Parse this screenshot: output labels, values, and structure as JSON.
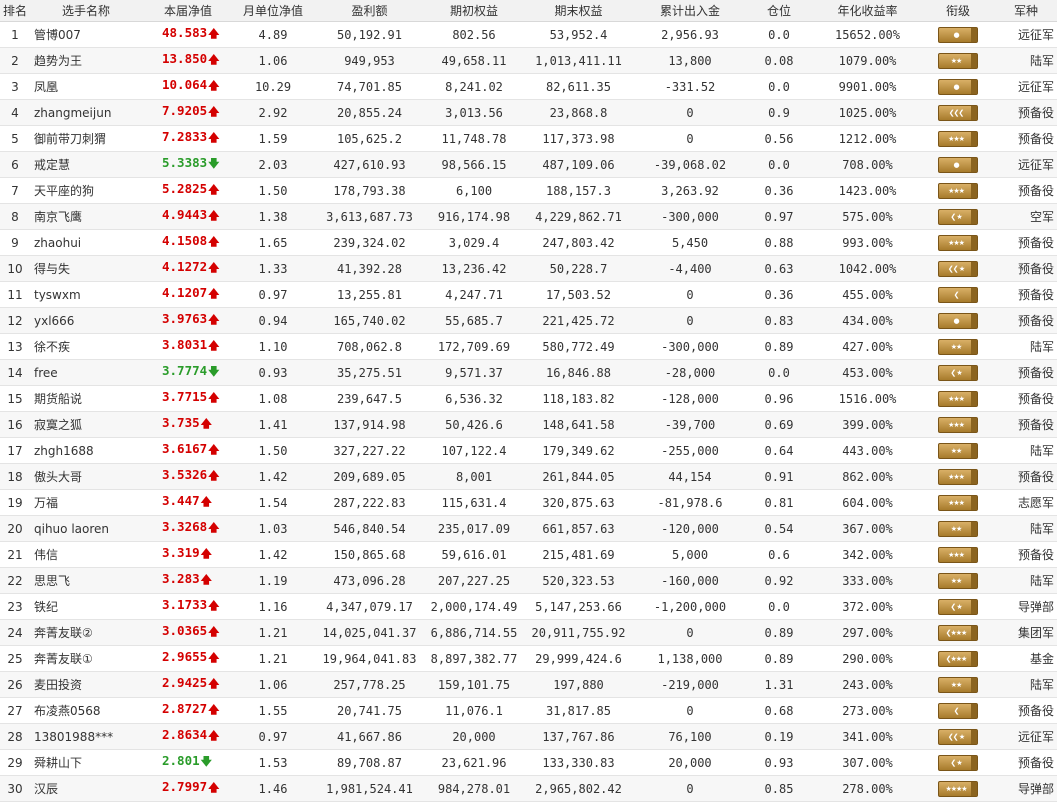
{
  "headers": [
    "排名",
    "选手名称",
    "本届净值",
    "月单位净值",
    "盈利额",
    "期初权益",
    "期末权益",
    "累计出入金",
    "仓位",
    "年化收益率",
    "衔级",
    "军种"
  ],
  "colors": {
    "up": "#d40000",
    "down": "#2a9c2a",
    "badge": "#c49a4c"
  },
  "rows": [
    {
      "rank": "1",
      "name": "管博007",
      "nav": "48.583",
      "dir": "up",
      "mnav": "4.89",
      "pnl": "50,192.91",
      "beg": "802.56",
      "end": "53,952.4",
      "flow": "2,956.93",
      "pos": "0.0",
      "ann": "15652.00%",
      "badge": "●",
      "army": "远征军"
    },
    {
      "rank": "2",
      "name": "趋势为王",
      "nav": "13.850",
      "dir": "up",
      "mnav": "1.06",
      "pnl": "949,953",
      "beg": "49,658.11",
      "end": "1,013,411.11",
      "flow": "13,800",
      "pos": "0.08",
      "ann": "1079.00%",
      "badge": "★★",
      "army": "陆军"
    },
    {
      "rank": "3",
      "name": "凤凰",
      "nav": "10.064",
      "dir": "up",
      "mnav": "10.29",
      "pnl": "74,701.85",
      "beg": "8,241.02",
      "end": "82,611.35",
      "flow": "-331.52",
      "pos": "0.0",
      "ann": "9901.00%",
      "badge": "●",
      "army": "远征军"
    },
    {
      "rank": "4",
      "name": "zhangmeijun",
      "nav": "7.9205",
      "dir": "up",
      "mnav": "2.92",
      "pnl": "20,855.24",
      "beg": "3,013.56",
      "end": "23,868.8",
      "flow": "0",
      "pos": "0.9",
      "ann": "1025.00%",
      "badge": "❮❮❮",
      "army": "预备役"
    },
    {
      "rank": "5",
      "name": "御前带刀刺猬",
      "nav": "7.2833",
      "dir": "up",
      "mnav": "1.59",
      "pnl": "105,625.2",
      "beg": "11,748.78",
      "end": "117,373.98",
      "flow": "0",
      "pos": "0.56",
      "ann": "1212.00%",
      "badge": "★★★",
      "army": "预备役"
    },
    {
      "rank": "6",
      "name": "戒定慧",
      "nav": "5.3383",
      "dir": "down",
      "mnav": "2.03",
      "pnl": "427,610.93",
      "beg": "98,566.15",
      "end": "487,109.06",
      "flow": "-39,068.02",
      "pos": "0.0",
      "ann": "708.00%",
      "badge": "●",
      "army": "远征军"
    },
    {
      "rank": "7",
      "name": "天平座的狗",
      "nav": "5.2825",
      "dir": "up",
      "mnav": "1.50",
      "pnl": "178,793.38",
      "beg": "6,100",
      "end": "188,157.3",
      "flow": "3,263.92",
      "pos": "0.36",
      "ann": "1423.00%",
      "badge": "★★★",
      "army": "预备役"
    },
    {
      "rank": "8",
      "name": "南京飞鹰",
      "nav": "4.9443",
      "dir": "up",
      "mnav": "1.38",
      "pnl": "3,613,687.73",
      "beg": "916,174.98",
      "end": "4,229,862.71",
      "flow": "-300,000",
      "pos": "0.97",
      "ann": "575.00%",
      "badge": "❮ ★",
      "army": "空军"
    },
    {
      "rank": "9",
      "name": "zhaohui",
      "nav": "4.1508",
      "dir": "up",
      "mnav": "1.65",
      "pnl": "239,324.02",
      "beg": "3,029.4",
      "end": "247,803.42",
      "flow": "5,450",
      "pos": "0.88",
      "ann": "993.00%",
      "badge": "★★★",
      "army": "预备役"
    },
    {
      "rank": "10",
      "name": "得与失",
      "nav": "4.1272",
      "dir": "up",
      "mnav": "1.33",
      "pnl": "41,392.28",
      "beg": "13,236.42",
      "end": "50,228.7",
      "flow": "-4,400",
      "pos": "0.63",
      "ann": "1042.00%",
      "badge": "❮❮ ★",
      "army": "预备役"
    },
    {
      "rank": "11",
      "name": "tyswxm",
      "nav": "4.1207",
      "dir": "up",
      "mnav": "0.97",
      "pnl": "13,255.81",
      "beg": "4,247.71",
      "end": "17,503.52",
      "flow": "0",
      "pos": "0.36",
      "ann": "455.00%",
      "badge": "❮",
      "army": "预备役"
    },
    {
      "rank": "12",
      "name": "yxl666",
      "nav": "3.9763",
      "dir": "up",
      "mnav": "0.94",
      "pnl": "165,740.02",
      "beg": "55,685.7",
      "end": "221,425.72",
      "flow": "0",
      "pos": "0.83",
      "ann": "434.00%",
      "badge": "●",
      "army": "预备役"
    },
    {
      "rank": "13",
      "name": "徐不疾",
      "nav": "3.8031",
      "dir": "up",
      "mnav": "1.10",
      "pnl": "708,062.8",
      "beg": "172,709.69",
      "end": "580,772.49",
      "flow": "-300,000",
      "pos": "0.89",
      "ann": "427.00%",
      "badge": "★★",
      "army": "陆军"
    },
    {
      "rank": "14",
      "name": "free",
      "nav": "3.7774",
      "dir": "down",
      "mnav": "0.93",
      "pnl": "35,275.51",
      "beg": "9,571.37",
      "end": "16,846.88",
      "flow": "-28,000",
      "pos": "0.0",
      "ann": "453.00%",
      "badge": "❮ ★",
      "army": "预备役"
    },
    {
      "rank": "15",
      "name": "期货船说",
      "nav": "3.7715",
      "dir": "up",
      "mnav": "1.08",
      "pnl": "239,647.5",
      "beg": "6,536.32",
      "end": "118,183.82",
      "flow": "-128,000",
      "pos": "0.96",
      "ann": "1516.00%",
      "badge": "★★★",
      "army": "预备役"
    },
    {
      "rank": "16",
      "name": "寂寞之狐",
      "nav": "3.735",
      "dir": "up",
      "mnav": "1.41",
      "pnl": "137,914.98",
      "beg": "50,426.6",
      "end": "148,641.58",
      "flow": "-39,700",
      "pos": "0.69",
      "ann": "399.00%",
      "badge": "★★★",
      "army": "预备役"
    },
    {
      "rank": "17",
      "name": "zhgh1688",
      "nav": "3.6167",
      "dir": "up",
      "mnav": "1.50",
      "pnl": "327,227.22",
      "beg": "107,122.4",
      "end": "179,349.62",
      "flow": "-255,000",
      "pos": "0.64",
      "ann": "443.00%",
      "badge": "★★",
      "army": "陆军"
    },
    {
      "rank": "18",
      "name": "傲头大哥",
      "nav": "3.5326",
      "dir": "up",
      "mnav": "1.42",
      "pnl": "209,689.05",
      "beg": "8,001",
      "end": "261,844.05",
      "flow": "44,154",
      "pos": "0.91",
      "ann": "862.00%",
      "badge": "★★★",
      "army": "预备役"
    },
    {
      "rank": "19",
      "name": "万福",
      "nav": "3.447",
      "dir": "up",
      "mnav": "1.54",
      "pnl": "287,222.83",
      "beg": "115,631.4",
      "end": "320,875.63",
      "flow": "-81,978.6",
      "pos": "0.81",
      "ann": "604.00%",
      "badge": "★★★",
      "army": "志愿军"
    },
    {
      "rank": "20",
      "name": "qihuo laoren",
      "nav": "3.3268",
      "dir": "up",
      "mnav": "1.03",
      "pnl": "546,840.54",
      "beg": "235,017.09",
      "end": "661,857.63",
      "flow": "-120,000",
      "pos": "0.54",
      "ann": "367.00%",
      "badge": "★★",
      "army": "陆军"
    },
    {
      "rank": "21",
      "name": "伟信",
      "nav": "3.319",
      "dir": "up",
      "mnav": "1.42",
      "pnl": "150,865.68",
      "beg": "59,616.01",
      "end": "215,481.69",
      "flow": "5,000",
      "pos": "0.6",
      "ann": "342.00%",
      "badge": "★★★",
      "army": "预备役"
    },
    {
      "rank": "22",
      "name": "思思飞",
      "nav": "3.283",
      "dir": "up",
      "mnav": "1.19",
      "pnl": "473,096.28",
      "beg": "207,227.25",
      "end": "520,323.53",
      "flow": "-160,000",
      "pos": "0.92",
      "ann": "333.00%",
      "badge": "★★",
      "army": "陆军"
    },
    {
      "rank": "23",
      "name": "铁纪",
      "nav": "3.1733",
      "dir": "up",
      "mnav": "1.16",
      "pnl": "4,347,079.17",
      "beg": "2,000,174.49",
      "end": "5,147,253.66",
      "flow": "-1,200,000",
      "pos": "0.0",
      "ann": "372.00%",
      "badge": "❮ ★",
      "army": "导弹部"
    },
    {
      "rank": "24",
      "name": "奔菁友联②",
      "nav": "3.0365",
      "dir": "up",
      "mnav": "1.21",
      "pnl": "14,025,041.37",
      "beg": "6,886,714.55",
      "end": "20,911,755.92",
      "flow": "0",
      "pos": "0.89",
      "ann": "297.00%",
      "badge": "❮★★★",
      "army": "集团军"
    },
    {
      "rank": "25",
      "name": "奔菁友联①",
      "nav": "2.9655",
      "dir": "up",
      "mnav": "1.21",
      "pnl": "19,964,041.83",
      "beg": "8,897,382.77",
      "end": "29,999,424.6",
      "flow": "1,138,000",
      "pos": "0.89",
      "ann": "290.00%",
      "badge": "❮★★★",
      "army": "基金"
    },
    {
      "rank": "26",
      "name": "麦田投资",
      "nav": "2.9425",
      "dir": "up",
      "mnav": "1.06",
      "pnl": "257,778.25",
      "beg": "159,101.75",
      "end": "197,880",
      "flow": "-219,000",
      "pos": "1.31",
      "ann": "243.00%",
      "badge": "★★",
      "army": "陆军"
    },
    {
      "rank": "27",
      "name": "布凌燕0568",
      "nav": "2.8727",
      "dir": "up",
      "mnav": "1.55",
      "pnl": "20,741.75",
      "beg": "11,076.1",
      "end": "31,817.85",
      "flow": "0",
      "pos": "0.68",
      "ann": "273.00%",
      "badge": "❮",
      "army": "预备役"
    },
    {
      "rank": "28",
      "name": "13801988***",
      "nav": "2.8634",
      "dir": "up",
      "mnav": "0.97",
      "pnl": "41,667.86",
      "beg": "20,000",
      "end": "137,767.86",
      "flow": "76,100",
      "pos": "0.19",
      "ann": "341.00%",
      "badge": "❮❮ ★",
      "army": "远征军"
    },
    {
      "rank": "29",
      "name": "舜耕山下",
      "nav": "2.801",
      "dir": "down",
      "mnav": "1.53",
      "pnl": "89,708.87",
      "beg": "23,621.96",
      "end": "133,330.83",
      "flow": "20,000",
      "pos": "0.93",
      "ann": "307.00%",
      "badge": "❮ ★",
      "army": "预备役"
    },
    {
      "rank": "30",
      "name": "汉辰",
      "nav": "2.7997",
      "dir": "up",
      "mnav": "1.46",
      "pnl": "1,981,524.41",
      "beg": "984,278.01",
      "end": "2,965,802.42",
      "flow": "0",
      "pos": "0.85",
      "ann": "278.00%",
      "badge": "★★★★",
      "army": "导弹部"
    }
  ]
}
